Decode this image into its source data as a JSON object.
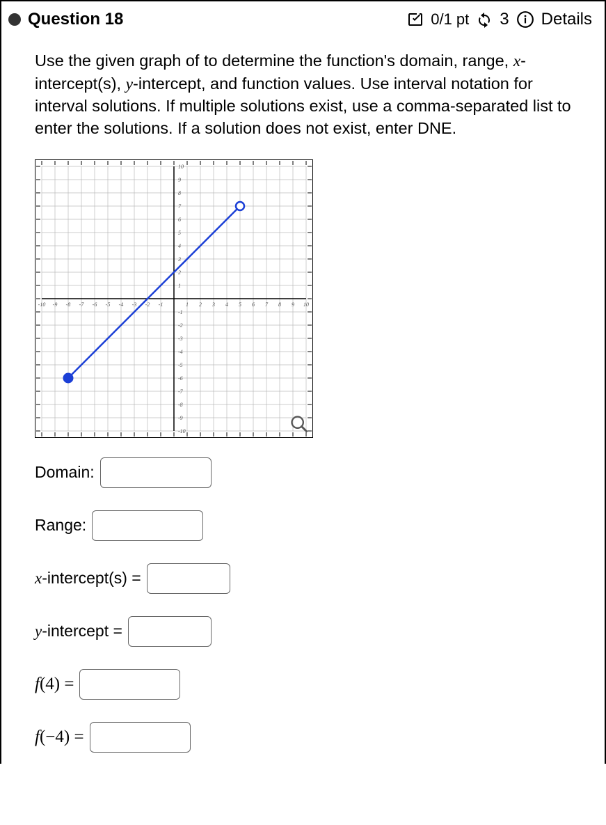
{
  "header": {
    "question_label": "Question 18",
    "points": "0/1 pt",
    "attempts": "3",
    "details": "Details"
  },
  "prompt": {
    "part1": "Use the given graph of to determine the function's domain, range, ",
    "xvar": "x",
    "part2": "-intercept(s), ",
    "yvar": "y",
    "part3": "-intercept, and function values. Use interval notation for interval solutions. If multiple solutions exist, use a comma-separated list to enter the solutions. If a solution does not exist, enter DNE."
  },
  "chart_data": {
    "type": "line",
    "xlim": [
      -10,
      10
    ],
    "ylim": [
      -10,
      10
    ],
    "x_ticks": [
      -10,
      -9,
      -8,
      -7,
      -6,
      -5,
      -4,
      -3,
      -2,
      -1,
      1,
      2,
      3,
      4,
      5,
      6,
      7,
      8,
      9,
      10
    ],
    "y_ticks": [
      -10,
      -9,
      -8,
      -7,
      -6,
      -5,
      -4,
      -3,
      -2,
      -1,
      1,
      2,
      3,
      4,
      5,
      6,
      7,
      8,
      9,
      10
    ],
    "series": [
      {
        "name": "f",
        "points": [
          {
            "x": -8,
            "y": -6,
            "endpoint": "closed"
          },
          {
            "x": 5,
            "y": 7,
            "endpoint": "open"
          }
        ]
      }
    ]
  },
  "fields": {
    "domain_label": "Domain:",
    "range_label": "Range:",
    "xint_label_var": "x",
    "xint_label_rest": "-intercept(s) =",
    "yint_label_var": "y",
    "yint_label_rest": "-intercept =",
    "f4_label": "f(4) =",
    "fneg4_label": "f(−4) ="
  }
}
